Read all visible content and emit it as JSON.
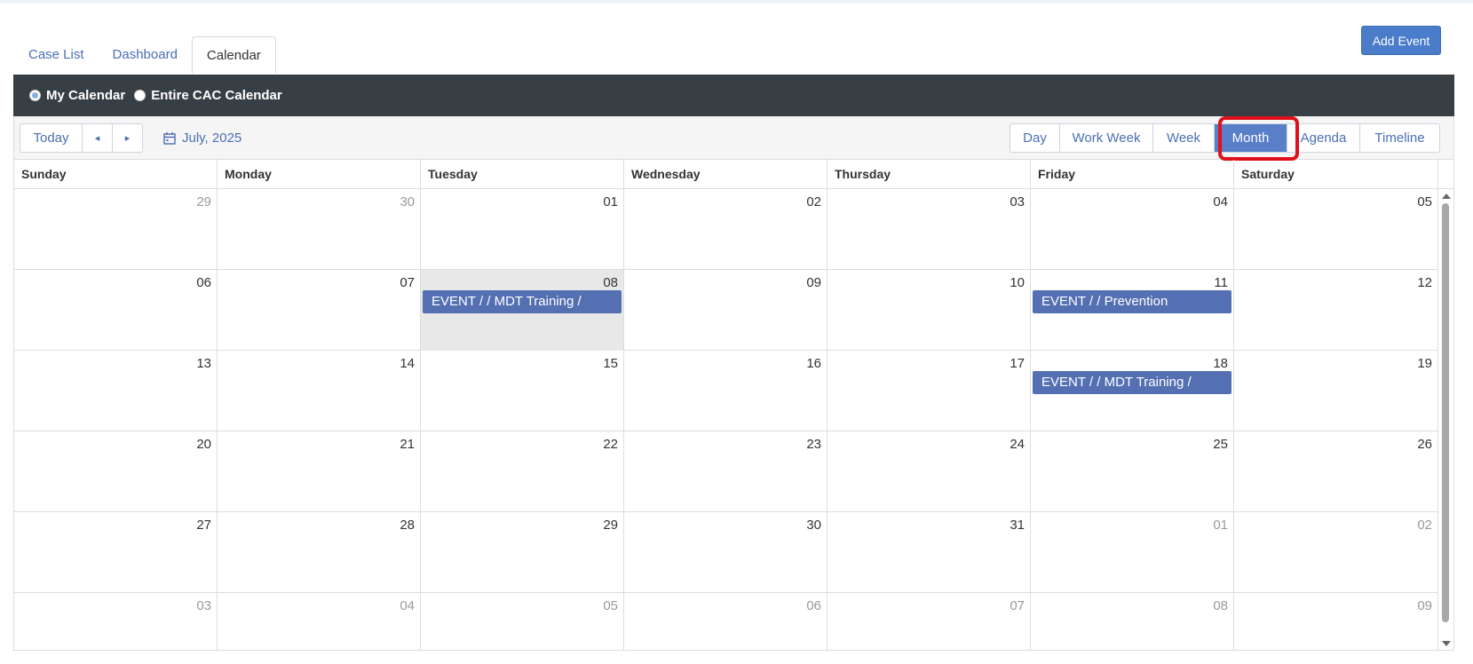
{
  "tabs": [
    {
      "label": "Case List"
    },
    {
      "label": "Dashboard"
    },
    {
      "label": "Calendar"
    }
  ],
  "add_event_label": "Add Event",
  "calendar_scope": {
    "options": [
      "My Calendar",
      "Entire CAC Calendar"
    ],
    "selected": "My Calendar"
  },
  "toolbar": {
    "today_label": "Today",
    "prev_icon": "◂",
    "next_icon": "▸",
    "date_label": "July, 2025",
    "views": [
      "Day",
      "Work Week",
      "Week",
      "Month",
      "Agenda",
      "Timeline"
    ],
    "selected_view": "Month"
  },
  "weekdays": [
    "Sunday",
    "Monday",
    "Tuesday",
    "Wednesday",
    "Thursday",
    "Friday",
    "Saturday"
  ],
  "weeks": [
    [
      {
        "d": "29",
        "o": true
      },
      {
        "d": "30",
        "o": true
      },
      {
        "d": "01"
      },
      {
        "d": "02"
      },
      {
        "d": "03"
      },
      {
        "d": "04"
      },
      {
        "d": "05"
      }
    ],
    [
      {
        "d": "06"
      },
      {
        "d": "07"
      },
      {
        "d": "08",
        "today": true,
        "event": "EVENT / / MDT Training /"
      },
      {
        "d": "09"
      },
      {
        "d": "10"
      },
      {
        "d": "11",
        "event": "EVENT / / Prevention"
      },
      {
        "d": "12"
      }
    ],
    [
      {
        "d": "13"
      },
      {
        "d": "14"
      },
      {
        "d": "15"
      },
      {
        "d": "16"
      },
      {
        "d": "17"
      },
      {
        "d": "18",
        "event": "EVENT / / MDT Training /"
      },
      {
        "d": "19"
      }
    ],
    [
      {
        "d": "20"
      },
      {
        "d": "21"
      },
      {
        "d": "22"
      },
      {
        "d": "23"
      },
      {
        "d": "24"
      },
      {
        "d": "25"
      },
      {
        "d": "26"
      }
    ],
    [
      {
        "d": "27"
      },
      {
        "d": "28"
      },
      {
        "d": "29"
      },
      {
        "d": "30"
      },
      {
        "d": "31"
      },
      {
        "d": "01",
        "o": true
      },
      {
        "d": "02",
        "o": true
      }
    ],
    [
      {
        "d": "03",
        "o": true
      },
      {
        "d": "04",
        "o": true
      },
      {
        "d": "05",
        "o": true
      },
      {
        "d": "06",
        "o": true
      },
      {
        "d": "07",
        "o": true
      },
      {
        "d": "08",
        "o": true
      },
      {
        "d": "09",
        "o": true
      }
    ]
  ],
  "colors": {
    "accent": "#5a7fc9",
    "event": "#5470b3",
    "dark_bar": "#383f44",
    "highlight": "#e0101a"
  }
}
